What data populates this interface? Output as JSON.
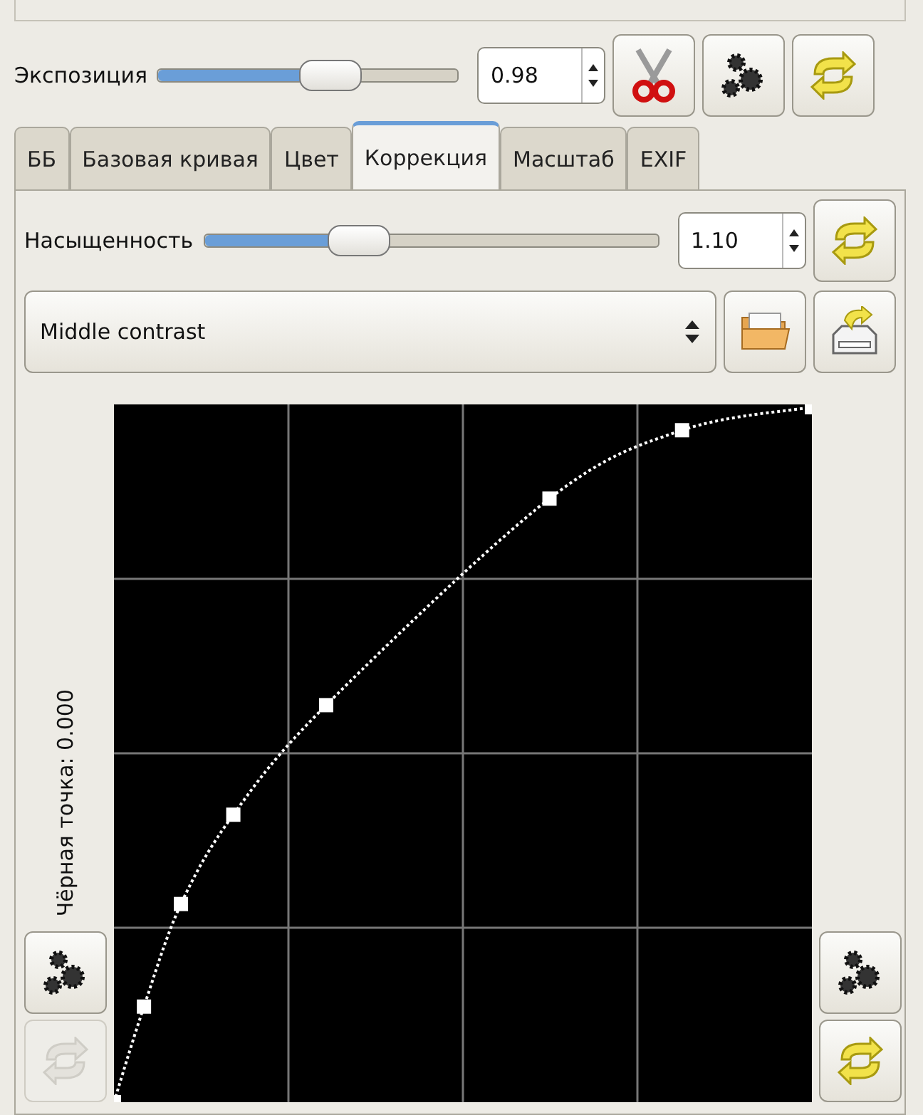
{
  "exposure": {
    "label": "Экспозиция",
    "level": 0.63,
    "value": "0.98",
    "buttons": [
      {
        "kind": "scissors",
        "disabled": false
      },
      {
        "kind": "gears",
        "disabled": false
      },
      {
        "kind": "refresh",
        "disabled": false
      }
    ]
  },
  "tabs": [
    {
      "label": "ББ",
      "selected": false
    },
    {
      "label": "Базовая кривая",
      "selected": false
    },
    {
      "label": "Цвет",
      "selected": false
    },
    {
      "label": "Коррекция",
      "selected": true
    },
    {
      "label": "Масштаб",
      "selected": false
    },
    {
      "label": "EXIF",
      "selected": false
    }
  ],
  "saturation": {
    "label": "Насыщенность",
    "level": 0.38,
    "value": "1.10",
    "buttons": [
      {
        "kind": "refresh",
        "disabled": false
      }
    ]
  },
  "curve_preset": {
    "value": "Middle contrast",
    "buttons": [
      {
        "kind": "folder",
        "disabled": false
      },
      {
        "kind": "save",
        "disabled": false
      }
    ]
  },
  "curve": {
    "black_point_label": "Чёрная точка: 0.000",
    "left_buttons": [
      {
        "kind": "gears",
        "disabled": false
      },
      {
        "kind": "refresh",
        "disabled": true
      }
    ],
    "right_buttons": [
      {
        "kind": "gears",
        "disabled": false
      },
      {
        "kind": "refresh",
        "disabled": false
      }
    ]
  }
}
